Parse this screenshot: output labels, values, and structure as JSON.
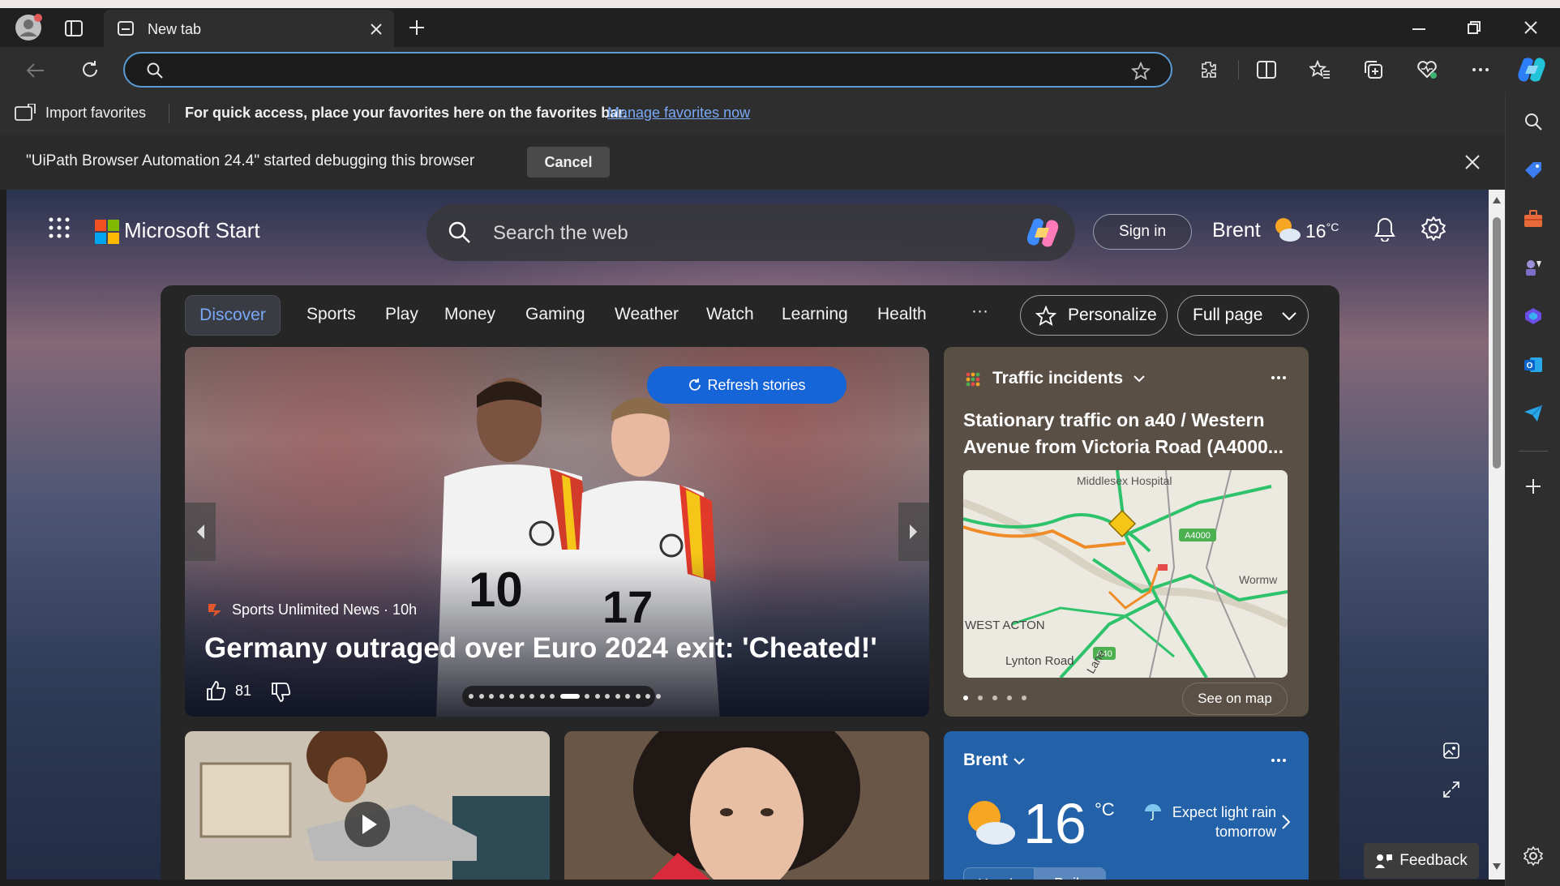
{
  "browser": {
    "tab_title": "New tab",
    "address_value": "",
    "address_placeholder": ""
  },
  "favorites_bar": {
    "import_label": "Import favorites",
    "message": "For quick access, place your favorites here on the favorites bar.",
    "manage_link": "Manage favorites now"
  },
  "debug_bar": {
    "message": "\"UiPath Browser Automation 24.4\" started debugging this browser",
    "cancel_label": "Cancel"
  },
  "header": {
    "brand": "Microsoft Start",
    "search_placeholder": "Search the web",
    "signin_label": "Sign in",
    "user_name": "Brent",
    "temperature": "16",
    "temp_unit": "°C"
  },
  "nav": {
    "items": [
      "Discover",
      "Sports",
      "Play",
      "Money",
      "Gaming",
      "Weather",
      "Watch",
      "Learning",
      "Health"
    ],
    "more": "···",
    "personalize": "Personalize",
    "layout": "Full page"
  },
  "hero": {
    "refresh_label": "Refresh stories",
    "source": "Sports Unlimited News · 10h",
    "title": "Germany outraged over Euro 2024 exit: 'Cheated!'",
    "likes": "81",
    "jersey_numbers": [
      "10",
      "17"
    ],
    "slide_count": 18,
    "active_slide": 9
  },
  "traffic": {
    "header": "Traffic incidents",
    "headline": "Stationary traffic on a40 / Western Avenue from Victoria Road (A4000...",
    "map_labels": [
      "Middlesex Hospital",
      "A4000",
      "Wormw",
      "WEST ACTON",
      "Lynton Road",
      "Lane",
      "A40"
    ],
    "see_map": "See on map",
    "page_count": 5
  },
  "weather": {
    "location": "Brent",
    "temperature": "16",
    "unit": "°C",
    "forecast": "Expect light rain tomorrow",
    "tabs": [
      "Hourly",
      "Daily"
    ]
  },
  "feedback_label": "Feedback",
  "colors": {
    "accent": "#1565d8",
    "link": "#79a9f7",
    "weather_card": "#2361a8",
    "traffic_card": "#5a4f45"
  }
}
